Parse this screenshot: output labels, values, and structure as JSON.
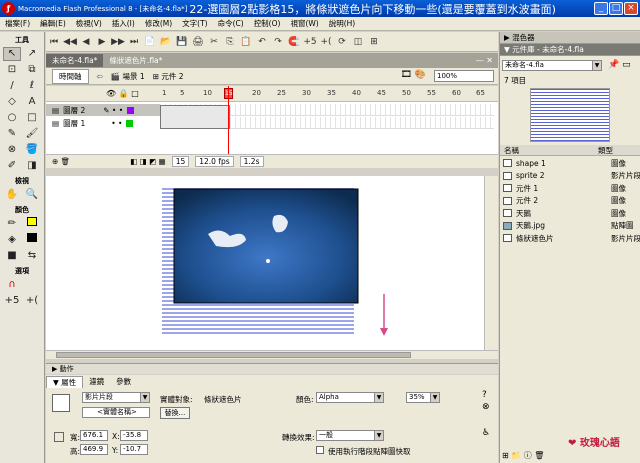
{
  "window": {
    "title_prefix": "Macromedia Flash Professional 8 - [未命名-4.fla*]",
    "tutorial_note": "22-選圖層2點影格15，將條狀遮色片向下移動一些(還是要覆蓋到水波畫面)",
    "buttons": [
      "_",
      "□",
      "×"
    ]
  },
  "menu": [
    "檔案(F)",
    "編輯(E)",
    "檢視(V)",
    "插入(I)",
    "修改(M)",
    "文字(T)",
    "命令(C)",
    "控制(O)",
    "視窗(W)",
    "說明(H)"
  ],
  "tools": {
    "header": "工具",
    "view_header": "檢視",
    "color_header": "顏色",
    "options_header": "選項",
    "items": [
      "↖",
      "↗",
      "⊡",
      "⧉",
      "/",
      "ℓ",
      "◇",
      "A",
      "○",
      "□",
      "✎",
      "🖌",
      "⊗",
      "🪣",
      "✐",
      "◨"
    ]
  },
  "toolbar_icons": [
    "⏮",
    "◀◀",
    "◀",
    "▶",
    "▶▶",
    "⏭",
    "📄",
    "📂",
    "💾",
    "🖨",
    "✂",
    "⎘",
    "📋",
    "↶",
    "↷",
    "🧲",
    "+5",
    "+(",
    "⟳",
    "◫",
    "⊞"
  ],
  "doc_tabs": [
    "未命名-4.fla*",
    "條狀遮色片.fla*"
  ],
  "scene_bar": {
    "timeline_btn": "時間軸",
    "scene": "場景 1",
    "symbol": "元件 2",
    "zoom": "100%"
  },
  "timeline": {
    "frame_numbers": [
      "1",
      "5",
      "10",
      "15",
      "20",
      "25",
      "30",
      "35",
      "40",
      "45",
      "50",
      "55",
      "60",
      "65"
    ],
    "layers": [
      {
        "name": "圖層 2",
        "selected": true
      },
      {
        "name": "圖層 1",
        "selected": false
      }
    ],
    "current_frame": "15",
    "fps": "12.0 fps",
    "time": "1.2s"
  },
  "action_panel": "▶ 動作",
  "property_tabs": [
    "▼ 屬性",
    "濾鏡",
    "參數"
  ],
  "properties": {
    "symbol_type": "影片片段",
    "instance_placeholder": "<實體名稱>",
    "instance_of_label": "實體對象:",
    "instance_of": "條狀遮色片",
    "swap_btn": "替換...",
    "color_label": "顏色:",
    "color_value": "Alpha",
    "alpha": "35%",
    "w_label": "寬:",
    "w": "676.1",
    "h_label": "高:",
    "h": "469.9",
    "x_label": "X:",
    "x": "-35.8",
    "y_label": "Y:",
    "y": "-10.7",
    "blend_label": "轉換效果:",
    "blend_value": "一般",
    "cache_label": "使用執行階段點陣圖快取"
  },
  "right_panel": {
    "color_panel": "▶ 混色器",
    "library_header": "▼ 元件庫 - 未命名-4.fla",
    "library_file": "未命名-4.fla",
    "item_count": "7 項目",
    "col_name": "名稱",
    "col_type": "類型",
    "items": [
      {
        "name": "shape 1",
        "type": "圖像"
      },
      {
        "name": "sprite 2",
        "type": "影片片段"
      },
      {
        "name": "元件 1",
        "type": "圖像"
      },
      {
        "name": "元件 2",
        "type": "圖像"
      },
      {
        "name": "天鵝",
        "type": "圖像"
      },
      {
        "name": "天鵝.jpg",
        "type": "點陣圖"
      },
      {
        "name": "條狀遮色片",
        "type": "影片片段"
      }
    ]
  },
  "watermark": "❤ 玫瑰心語",
  "colors": {
    "accent": "#0a5fd8",
    "stripe": "#9ea4e8",
    "playhead": "#ff0000"
  }
}
